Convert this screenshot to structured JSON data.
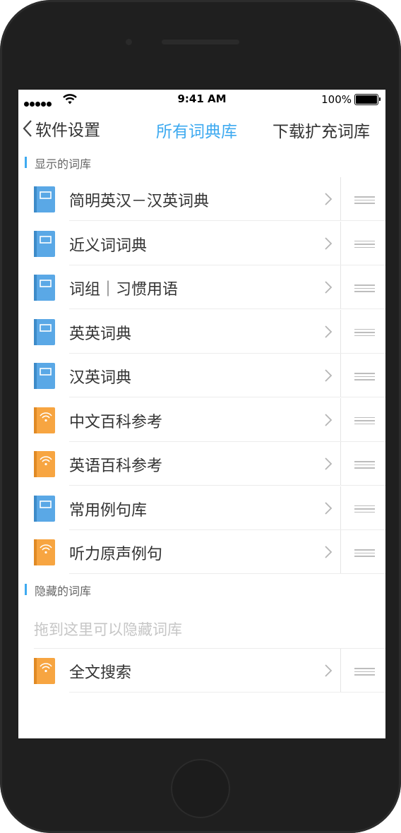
{
  "status_bar": {
    "time": "9:41 AM",
    "battery": "100%",
    "signal_icon": "signal-dots-icon",
    "wifi_icon": "wifi-icon",
    "battery_icon": "battery-icon"
  },
  "nav": {
    "back_label": "软件设置",
    "title": "所有词典库",
    "right_action": "下载扩充词库",
    "accent_color": "#3eaaf0"
  },
  "shown_section": {
    "title": "显示的词库",
    "items": [
      {
        "label": "简明英汉－汉英词典",
        "icon": "blue-book-icon"
      },
      {
        "label": "近义词词典",
        "icon": "blue-book-icon"
      },
      {
        "label": "词组｜习惯用语",
        "icon": "blue-book-icon"
      },
      {
        "label": "英英词典",
        "icon": "blue-book-icon"
      },
      {
        "label": "汉英词典",
        "icon": "blue-book-icon"
      },
      {
        "label": "中文百科参考",
        "icon": "orange-online-book-icon"
      },
      {
        "label": "英语百科参考",
        "icon": "orange-online-book-icon"
      },
      {
        "label": "常用例句库",
        "icon": "blue-book-icon"
      },
      {
        "label": "听力原声例句",
        "icon": "orange-online-book-icon"
      }
    ]
  },
  "hidden_section": {
    "title": "隐藏的词库",
    "hint": "拖到这里可以隐藏词库",
    "items": [
      {
        "label": "全文搜索",
        "icon": "orange-online-book-icon"
      }
    ]
  },
  "colors": {
    "blue_book": "#5aa8e6",
    "orange_book": "#f7a541"
  }
}
